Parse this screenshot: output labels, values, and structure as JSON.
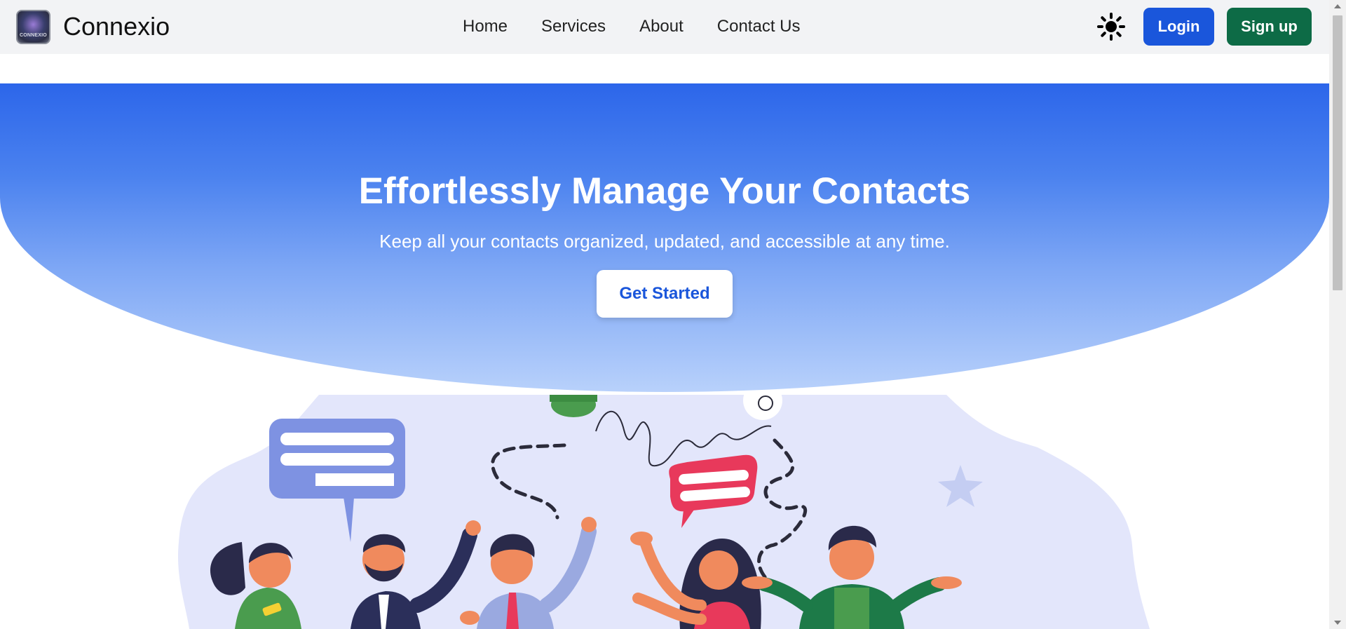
{
  "navbar": {
    "logo_text": "CONNEXIO",
    "brand": "Connexio",
    "links": [
      "Home",
      "Services",
      "About",
      "Contact Us"
    ],
    "theme_icon": "sun-icon",
    "login_label": "Login",
    "signup_label": "Sign up"
  },
  "hero": {
    "title": "Effortlessly Manage Your Contacts",
    "subtitle": "Keep all your contacts organized, updated, and accessible at any time.",
    "cta_label": "Get Started"
  },
  "colors": {
    "primary": "#1a56db",
    "signup": "#0d6b46",
    "hero_top": "#2c66ea",
    "hero_bottom": "#b8d1fb",
    "illustration_bg": "#e3e6fb"
  }
}
